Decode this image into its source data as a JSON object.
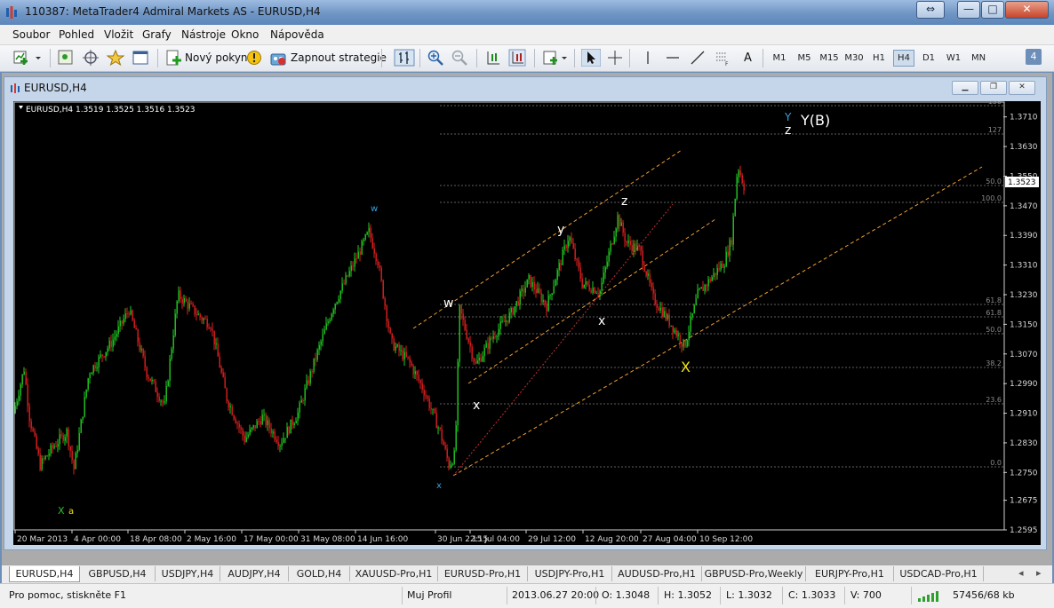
{
  "window": {
    "title": "110387: MetaTrader4 Admiral Markets AS - EURUSD,H4",
    "buttons": {
      "restore": "⇔",
      "minimize": "—",
      "maximize": "□",
      "close": "✕"
    }
  },
  "menu": {
    "items": [
      "Soubor",
      "Pohled",
      "Vložit",
      "Grafy",
      "Nástroje",
      "Okno",
      "Nápověda"
    ]
  },
  "toolbar": {
    "new_order": "Nový pokyn",
    "expert_toggle": "Zapnout strategie",
    "timeframes": [
      "M1",
      "M5",
      "M15",
      "M30",
      "H1",
      "H4",
      "D1",
      "W1",
      "MN"
    ],
    "active_timeframe": "H4",
    "text_tool": "A",
    "counter_badge": "4"
  },
  "chart_window": {
    "title": "EURUSD,H4",
    "info": "EURUSD,H4  1.3519 1.3525 1.3516 1.3523",
    "current_price": "1.3523",
    "colors": {
      "background": "#000000",
      "bull": "#22cc22",
      "bear": "#e02020",
      "channel": "#f0a030",
      "fib": "#808080",
      "price_tag": "#ffffff"
    }
  },
  "chart_data": {
    "type": "candlestick",
    "symbol": "EURUSD",
    "timeframe": "H4",
    "ylim": [
      1.2595,
      1.375
    ],
    "y_ticks": [
      "1.3710",
      "1.3630",
      "1.3550",
      "1.3470",
      "1.3390",
      "1.3310",
      "1.3230",
      "1.3150",
      "1.3070",
      "1.2990",
      "1.2910",
      "1.2830",
      "1.2750",
      "1.2675",
      "1.2595"
    ],
    "x_ticks": [
      "20 Mar 2013",
      "4 Apr 00:00",
      "18 Apr 08:00",
      "2 May 16:00",
      "17 May 00:00",
      "31 May 08:00",
      "14 Jun 16:00",
      "30 Jun 22:15",
      "15 Jul 04:00",
      "29 Jul 12:00",
      "12 Aug 20:00",
      "27 Aug 04:00",
      "10 Sep 12:00"
    ],
    "fib_levels": [
      "138",
      "127",
      "50.0",
      "100.0",
      "61.8",
      "61.8",
      "50.0",
      "38.2",
      "23.6",
      "0.0"
    ],
    "wave_labels": [
      "w",
      "w",
      "x",
      "x",
      "y",
      "x",
      "z",
      "X",
      "Y",
      "z",
      "Y(B)",
      "X",
      "a"
    ]
  },
  "tabs": [
    "EURUSD,H4",
    "GBPUSD,H4",
    "USDJPY,H4",
    "AUDJPY,H4",
    "GOLD,H4",
    "XAUUSD-Pro,H1",
    "EURUSD-Pro,H1",
    "USDJPY-Pro,H1",
    "AUDUSD-Pro,H1",
    "GBPUSD-Pro,Weekly",
    "EURJPY-Pro,H1",
    "USDCAD-Pro,H1"
  ],
  "tab_nav": {
    "left": "◂",
    "right": "▸"
  },
  "status": {
    "help": "Pro pomoc, stiskněte F1",
    "profile": "Muj Profil",
    "datetime": "2013.06.27 20:00",
    "open": "O: 1.3048",
    "high": "H: 1.3052",
    "low": "L: 1.3032",
    "close": "C: 1.3033",
    "volume": "V: 700",
    "traffic": "57456/68 kb"
  }
}
